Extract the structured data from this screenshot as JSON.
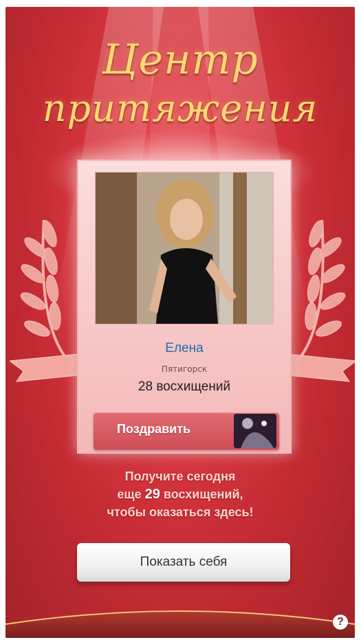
{
  "title": {
    "line1": "Центр",
    "line2": "притяжения"
  },
  "profile": {
    "name": "Елена",
    "city": "Пятигорск",
    "admirations": "28 восхищений"
  },
  "congrats_button": {
    "label": "Поздравить"
  },
  "promo": {
    "line1": "Получите сегодня",
    "line2_prefix": "еще",
    "line2_number": "29",
    "line2_suffix": "восхищений,",
    "line3": "чтобы оказаться здесь!"
  },
  "show_button": {
    "label": "Показать себя"
  },
  "help": {
    "label": "?"
  },
  "icons": {
    "help": "question-icon",
    "laurel": "laurel-wreath-icon"
  },
  "colors": {
    "background": "#c42b33",
    "title": "#ffd874",
    "name_link": "#1b6fb0",
    "congrats_button": "#d04d56"
  }
}
